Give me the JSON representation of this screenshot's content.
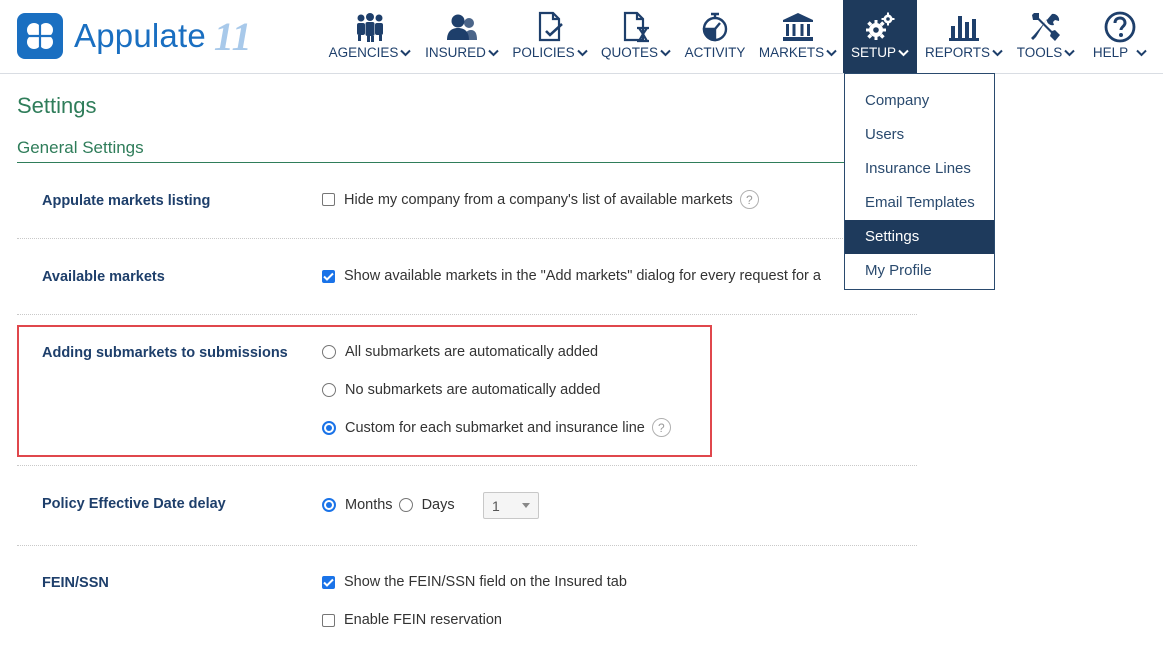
{
  "brand": {
    "name": "Appulate",
    "version": "11",
    "logo_color": "#1a6fc1"
  },
  "nav": [
    {
      "label": "AGENCIES",
      "icon": "agencies-icon",
      "active": false,
      "has_dropdown": true
    },
    {
      "label": "INSURED",
      "icon": "insured-icon",
      "active": false,
      "has_dropdown": true
    },
    {
      "label": "POLICIES",
      "icon": "policies-icon",
      "active": false,
      "has_dropdown": true
    },
    {
      "label": "QUOTES",
      "icon": "quotes-icon",
      "active": false,
      "has_dropdown": true
    },
    {
      "label": "ACTIVITY",
      "icon": "activity-icon",
      "active": false,
      "has_dropdown": false
    },
    {
      "label": "MARKETS",
      "icon": "markets-icon",
      "active": false,
      "has_dropdown": true
    },
    {
      "label": "SETUP",
      "icon": "gears-icon",
      "active": true,
      "has_dropdown": true
    },
    {
      "label": "REPORTS",
      "icon": "bar-chart-icon",
      "active": false,
      "has_dropdown": true
    },
    {
      "label": "TOOLS",
      "icon": "tools-icon",
      "active": false,
      "has_dropdown": true
    },
    {
      "label": "HELP",
      "icon": "help-circle-icon",
      "active": false,
      "has_dropdown": true
    }
  ],
  "setup_menu": {
    "items": [
      "Company",
      "Users",
      "Insurance Lines",
      "Email Templates",
      "Settings",
      "My Profile"
    ],
    "selected": "Settings"
  },
  "page": {
    "title": "Settings",
    "section": "General Settings"
  },
  "settings": {
    "markets_listing": {
      "label": "Appulate markets listing",
      "option": "Hide my company from a company's list of available markets",
      "checked": false
    },
    "available_markets": {
      "label": "Available markets",
      "option": "Show available markets in the \"Add markets\" dialog for every request for a",
      "checked": true
    },
    "submarkets": {
      "label": "Adding submarkets to submissions",
      "options": [
        "All submarkets are automatically added",
        "No submarkets are automatically added",
        "Custom for each submarket and insurance line"
      ],
      "selected_index": 2
    },
    "effective_date": {
      "label": "Policy Effective Date delay",
      "unit_months": "Months",
      "unit_days": "Days",
      "selected_unit": "Months",
      "value": "1"
    },
    "fein": {
      "label": "FEIN/SSN",
      "option_show": "Show the FEIN/SSN field on the Insured tab",
      "show_checked": true,
      "option_reserve": "Enable FEIN reservation",
      "reserve_checked": false
    }
  },
  "colors": {
    "accent": "#1e3a5c",
    "section": "#2f7d5a",
    "highlight": "#e0474c",
    "check": "#1a73e8"
  }
}
